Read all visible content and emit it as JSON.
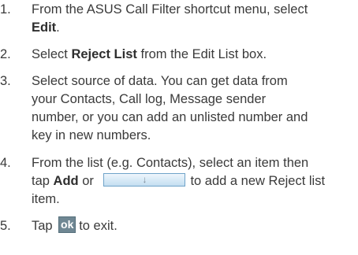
{
  "steps": [
    {
      "number": "1.",
      "lines": [
        [
          "From the ASUS Call Filter shortcut menu, select"
        ],
        [
          "Edit",
          "."
        ]
      ]
    },
    {
      "number": "2.",
      "lines": [
        [
          "Select ",
          "Reject List",
          " from the Edit List box."
        ]
      ]
    },
    {
      "number": "3.",
      "lines": [
        [
          "Select source of data. You can get data from"
        ],
        [
          "your Contacts, Call log, Message sender"
        ],
        [
          "number, or you can add an unlisted number and"
        ],
        [
          "key in new numbers."
        ]
      ]
    },
    {
      "number": "4.",
      "lines": [
        [
          "From the list (e.g. Contacts), select an item then"
        ],
        [
          "tap ",
          "Add",
          " or ",
          "to add a new Reject list"
        ],
        [
          "item."
        ]
      ]
    },
    {
      "number": "5.",
      "lines": [
        [
          "Tap ",
          "to exit."
        ]
      ]
    }
  ],
  "icons": {
    "add_button_glyph": "↓",
    "ok_button_label": "ok"
  }
}
